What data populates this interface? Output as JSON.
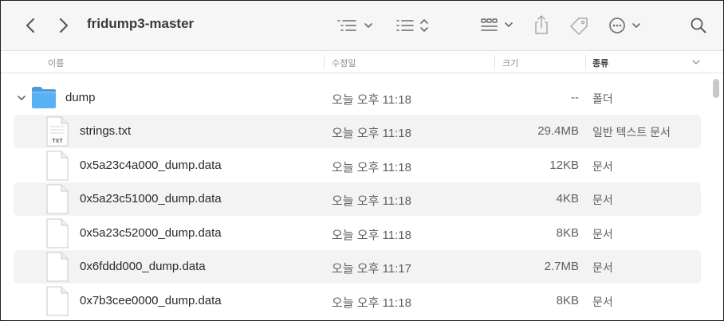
{
  "window": {
    "title": "fridump3-master"
  },
  "toolbar": {
    "icons": [
      "back-icon",
      "forward-icon",
      "list-view-icon",
      "group-icon",
      "grid-view-icon",
      "share-icon",
      "tag-icon",
      "more-icon",
      "search-icon"
    ]
  },
  "columns": {
    "name": "이름",
    "date": "수정일",
    "size": "크기",
    "kind": "종류"
  },
  "rows": [
    {
      "name": "dump",
      "date": "오늘 오후 11:18",
      "size": "--",
      "kind": "폴더",
      "type": "folder"
    },
    {
      "name": "strings.txt",
      "date": "오늘 오후 11:18",
      "size": "29.4MB",
      "kind": "일반 텍스트 문서",
      "type": "txt",
      "badge": "TXT"
    },
    {
      "name": "0x5a23c4a000_dump.data",
      "date": "오늘 오후 11:18",
      "size": "12KB",
      "kind": "문서",
      "type": "doc"
    },
    {
      "name": "0x5a23c51000_dump.data",
      "date": "오늘 오후 11:18",
      "size": "4KB",
      "kind": "문서",
      "type": "doc"
    },
    {
      "name": "0x5a23c52000_dump.data",
      "date": "오늘 오후 11:18",
      "size": "8KB",
      "kind": "문서",
      "type": "doc"
    },
    {
      "name": "0x6fddd000_dump.data",
      "date": "오늘 오후 11:17",
      "size": "2.7MB",
      "kind": "문서",
      "type": "doc"
    },
    {
      "name": "0x7b3cee0000_dump.data",
      "date": "오늘 오후 11:18",
      "size": "8KB",
      "kind": "문서",
      "type": "doc"
    }
  ],
  "colors": {
    "folder": "#4aa8ec",
    "row_alt": "#f3f3f3",
    "toolbar_bg": "#f6f6f6"
  }
}
